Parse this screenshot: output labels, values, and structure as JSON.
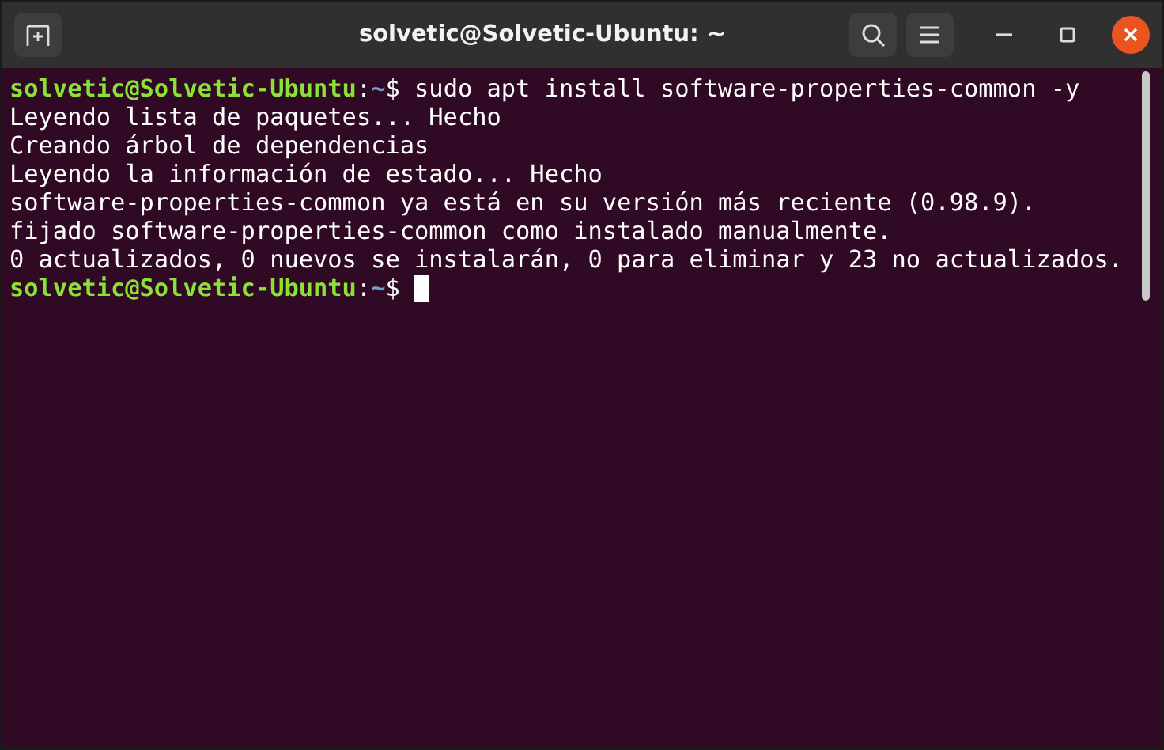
{
  "window": {
    "title": "solvetic@Solvetic-Ubuntu: ~"
  },
  "terminal": {
    "lines": [
      {
        "kind": "prompt",
        "user_host": "solvetic@Solvetic-Ubuntu",
        "separator": ":",
        "path": "~",
        "symbol": "$",
        "command": "sudo apt install software-properties-common -y",
        "cursor": false
      },
      {
        "kind": "output",
        "text": "Leyendo lista de paquetes... Hecho"
      },
      {
        "kind": "output",
        "text": "Creando árbol de dependencias"
      },
      {
        "kind": "output",
        "text": "Leyendo la información de estado... Hecho"
      },
      {
        "kind": "output",
        "text": "software-properties-common ya está en su versión más reciente (0.98.9)."
      },
      {
        "kind": "output",
        "text": "fijado software-properties-common como instalado manualmente."
      },
      {
        "kind": "output",
        "text": "0 actualizados, 0 nuevos se instalarán, 0 para eliminar y 23 no actualizados."
      },
      {
        "kind": "prompt",
        "user_host": "solvetic@Solvetic-Ubuntu",
        "separator": ":",
        "path": "~",
        "symbol": "$",
        "cursor": true
      }
    ]
  }
}
